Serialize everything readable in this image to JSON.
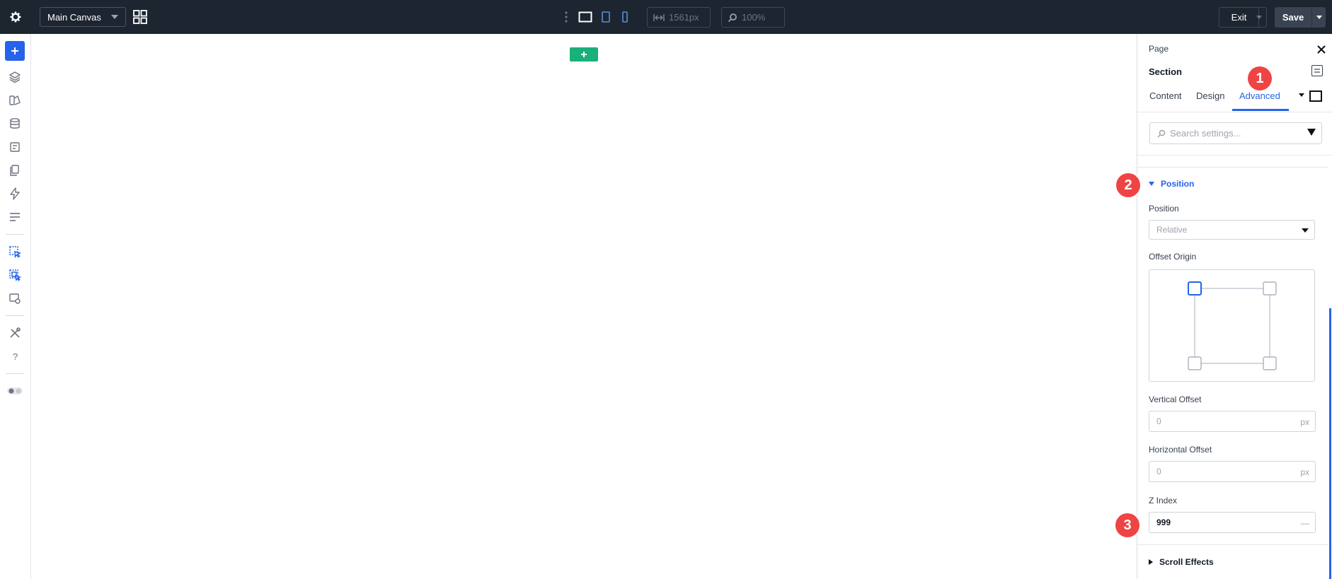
{
  "topbar": {
    "canvas_select": "Main Canvas",
    "width_readout": "1561px",
    "zoom_readout": "100%",
    "exit_label": "Exit",
    "save_label": "Save"
  },
  "panel": {
    "breadcrumb": "Page",
    "title": "Section",
    "tabs": [
      {
        "label": "Content",
        "active": false
      },
      {
        "label": "Design",
        "active": false
      },
      {
        "label": "Advanced",
        "active": true
      }
    ],
    "search_placeholder": "Search settings...",
    "position_section": {
      "heading": "Position",
      "position_label": "Position",
      "position_value": "Relative",
      "offset_origin_label": "Offset Origin",
      "vertical_offset_label": "Vertical Offset",
      "vertical_offset_value": "0",
      "vertical_offset_unit": "px",
      "horizontal_offset_label": "Horizontal Offset",
      "horizontal_offset_value": "0",
      "horizontal_offset_unit": "px",
      "z_index_label": "Z Index",
      "z_index_value": "999",
      "z_index_unit": "—"
    },
    "scroll_effects_heading": "Scroll Effects"
  },
  "badges": [
    "1",
    "2",
    "3"
  ],
  "colors": {
    "topbar_bg": "#1d2531",
    "accent": "#2563eb",
    "add_section": "#19b07a",
    "badge": "#ef4444"
  }
}
